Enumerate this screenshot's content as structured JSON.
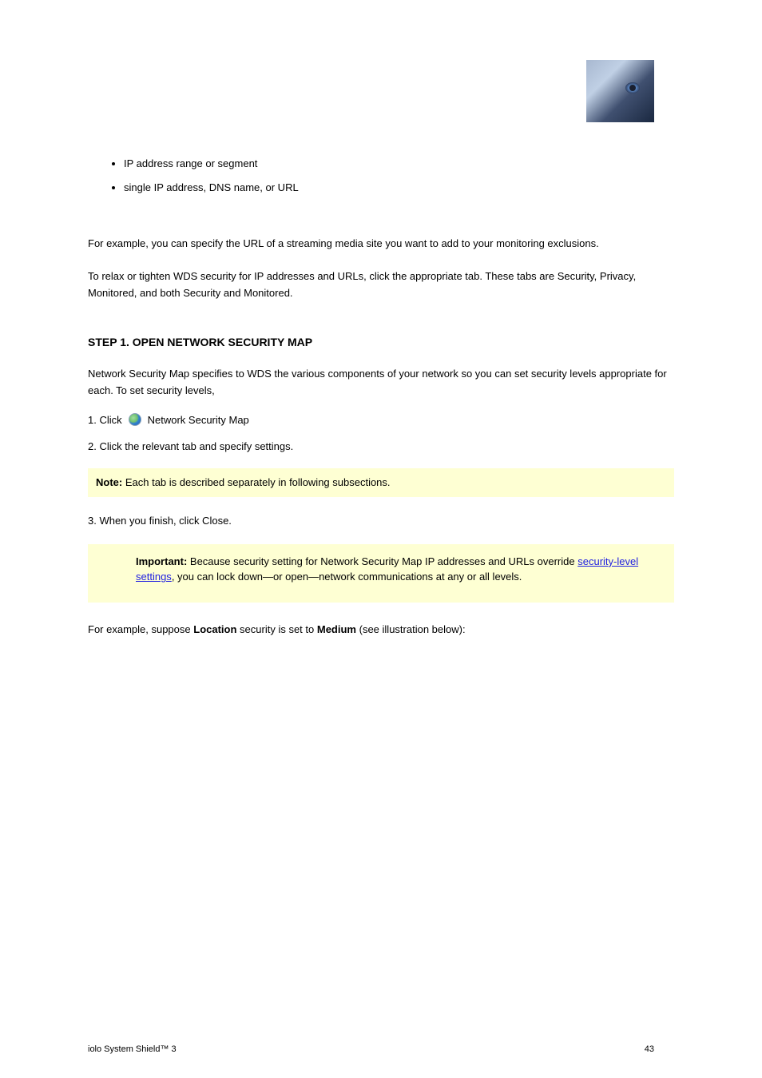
{
  "headerImageAlt": "wolf-eye-image",
  "bullets": [
    "IP address range or segment",
    "single IP address, DNS name, or URL"
  ],
  "section1": "For example, you can specify the URL of a streaming media site you want to add to your monitoring exclusions.",
  "section2": "To relax or tighten WDS security for IP addresses and URLs, click the appropriate tab. These tabs are Security, Privacy, Monitored, and both Security and Monitored.",
  "stepHeading": "STEP 1. OPEN NETWORK SECURITY MAP",
  "section3": "Network Security Map specifies to WDS the various components of your network so you can set security levels appropriate for each. To set security levels,",
  "stepPrefix": "1. Click",
  "stepLinkText": "Network Security Map",
  "section4": "2. Click the relevant tab and specify settings.",
  "note": {
    "label": "Note:",
    "text": "Each tab is described separately in following subsections."
  },
  "section5": "3. When you finish, click Close.",
  "important": {
    "label": "Important:",
    "textPart1": "Because security setting for Network Security Map IP addresses and URLs override",
    "linkText": "security-level settings",
    "textPart2": ", you can lock down—or open—network communications at any or all levels."
  },
  "section6": {
    "part1": "For example, suppose",
    "bold1": "Location",
    "part2": "security is set to",
    "bold2": "Medium",
    "part3": "(see illustration below):"
  },
  "footer": {
    "left": "iolo System Shield™ 3",
    "right": "43"
  }
}
